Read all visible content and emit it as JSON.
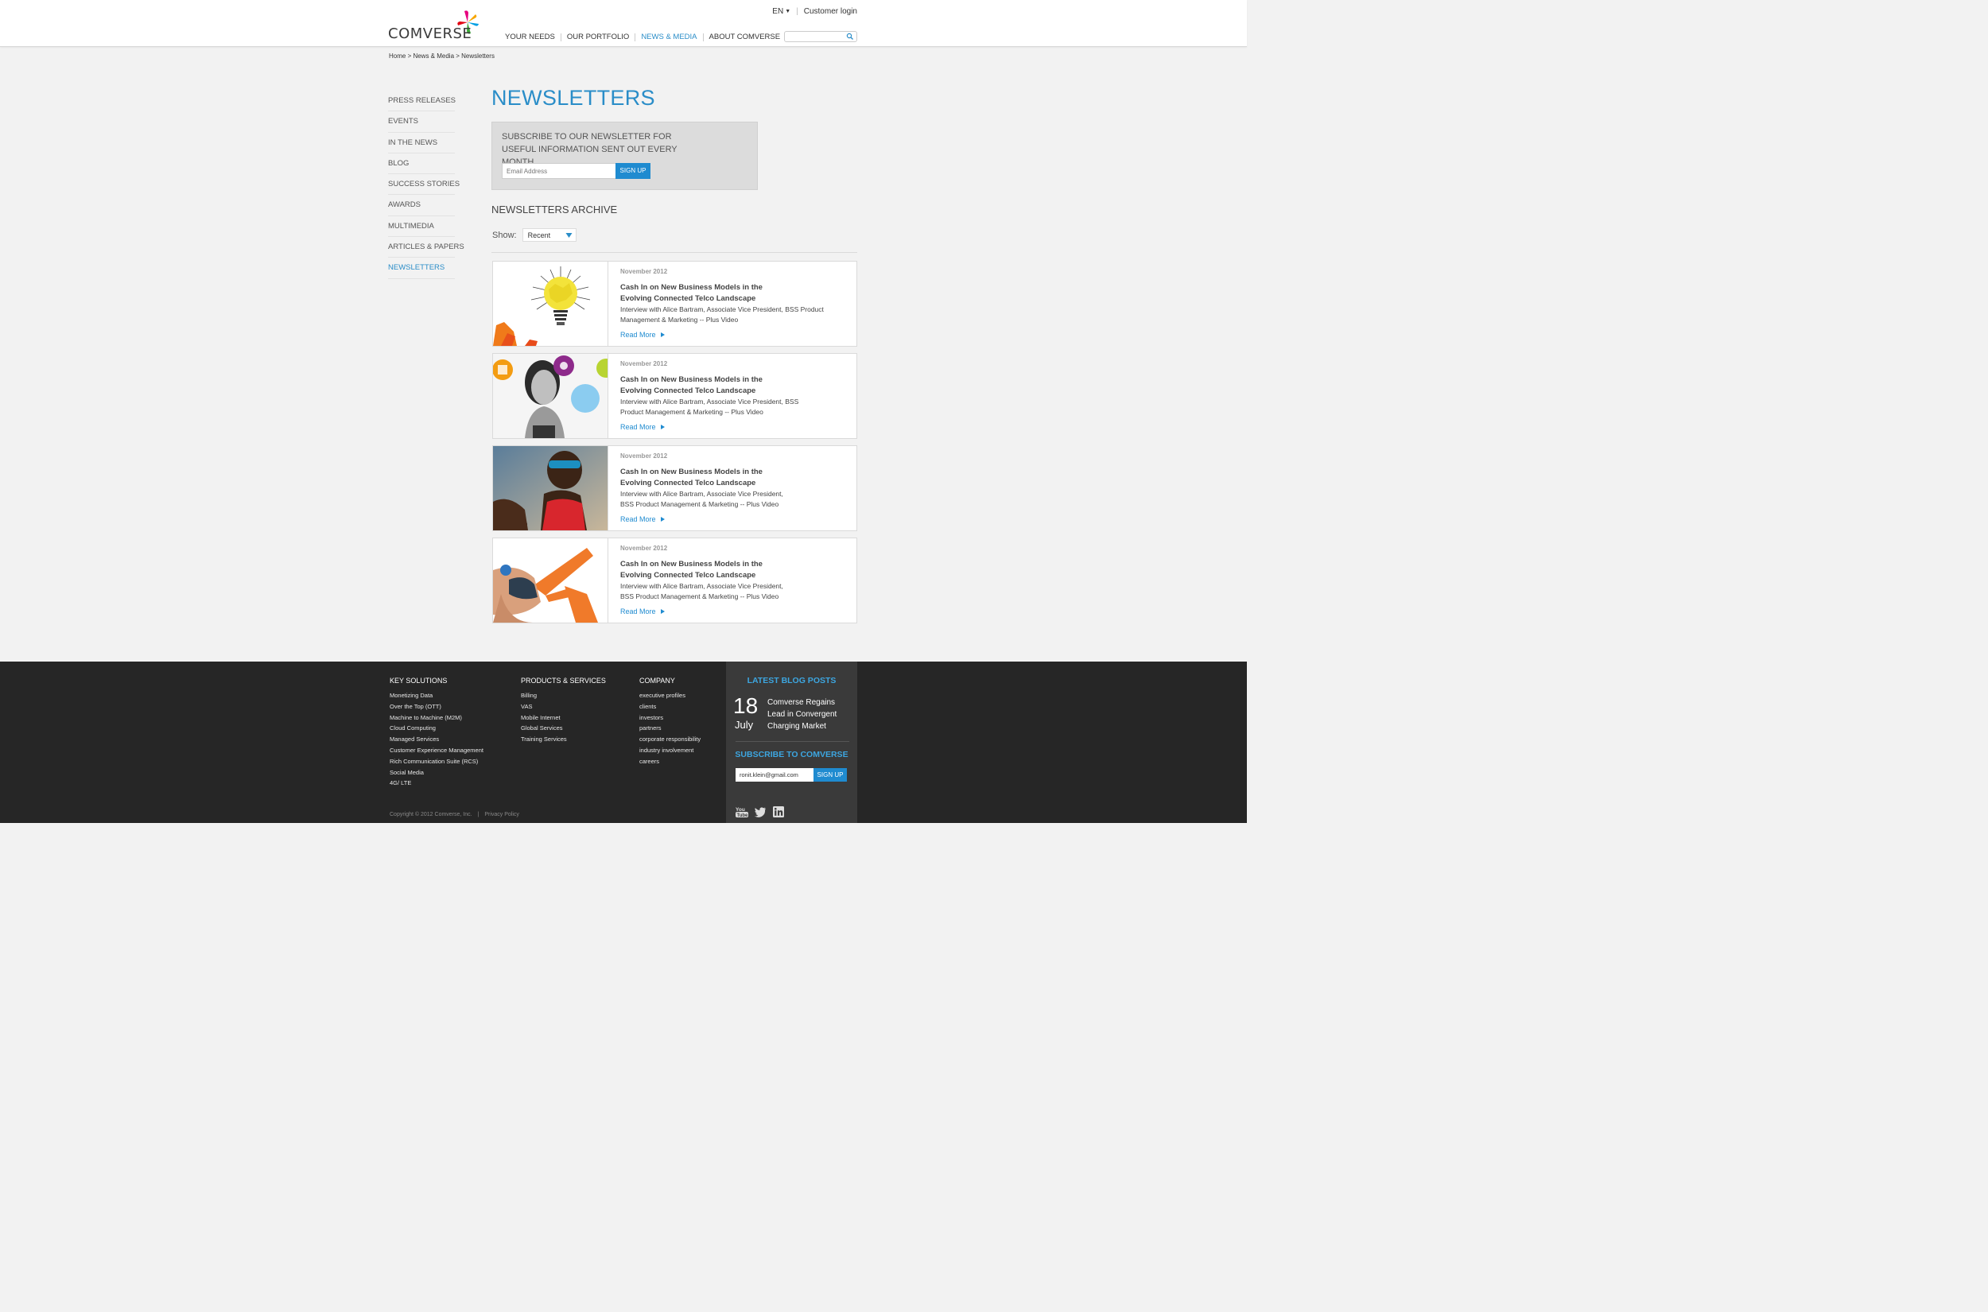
{
  "header": {
    "logo_text": "COMVERSE",
    "lang": "EN",
    "customer_login": "Customer login",
    "nav": [
      "YOUR NEEDS",
      "OUR PORTFOLIO",
      "NEWS & MEDIA",
      "ABOUT COMVERSE"
    ],
    "active_nav": "NEWS & MEDIA",
    "search_placeholder": ""
  },
  "breadcrumb": "Home > News & Media > Newsletters",
  "sidebar": {
    "items": [
      "PRESS RELEASES",
      "EVENTS",
      "IN THE NEWS",
      "BLOG",
      "SUCCESS STORIES",
      "AWARDS",
      "MULTIMEDIA",
      "ARTICLES & PAPERS",
      "NEWSLETTERS"
    ],
    "active": "NEWSLETTERS"
  },
  "main": {
    "title": "NEWSLETTERS",
    "subscribe": {
      "text": "SUBSCRIBE TO OUR NEWSLETTER FOR USEFUL INFORMATION SENT OUT EVERY MONTH.",
      "placeholder": "Email Address",
      "button": "SIGN UP"
    },
    "archive_title": "NEWSLETTERS ARCHIVE",
    "show_label": "Show:",
    "show_value": "Recent",
    "cards": [
      {
        "date": "November 2012",
        "title": "Cash In on New Business Models in the Evolving Connected Telco Landscape",
        "desc": "Interview with Alice Bartram, Associate Vice President, BSS Product Management & Marketing -- Plus Video",
        "more": "Read More",
        "thumb": "lightbulb-image"
      },
      {
        "date": "November 2012",
        "title": "Cash In on New Business Models in the Evolving Connected Telco Landscape",
        "desc": "Interview with Alice Bartram, Associate Vice President, BSS Product Management & Marketing -- Plus Video",
        "more": "Read More",
        "thumb": "woman-app-icons-image"
      },
      {
        "date": "November 2012",
        "title": "Cash In on New Business Models in the Evolving Connected Telco Landscape",
        "desc": "Interview with Alice Bartram, Associate Vice President, BSS Product Management & Marketing -- Plus Video",
        "more": "Read More",
        "thumb": "runner-image"
      },
      {
        "date": "November 2012",
        "title": "Cash In on New Business Models in the Evolving Connected Telco Landscape",
        "desc": "Interview with Alice Bartram, Associate Vice President, BSS Product Management & Marketing -- Plus Video",
        "more": "Read More",
        "thumb": "slingshot-image"
      }
    ]
  },
  "footer": {
    "key_solutions": {
      "heading": "KEY SOLUTIONS",
      "links": [
        "Monetizing Data",
        "Over the Top (OTT)",
        "Machine to Machine (M2M)",
        "Cloud Computing",
        "Managed Services",
        "Customer Experience Management",
        "Rich Communication Suite (RCS)",
        "Social Media",
        "4G/ LTE"
      ]
    },
    "products": {
      "heading": "PRODUCTS & SERVICES",
      "links": [
        "Billing",
        "VAS",
        "Mobile Internet",
        "Global Services",
        "Training Services"
      ]
    },
    "company": {
      "heading": "COMPANY",
      "links": [
        "executive profiles",
        "clients",
        "investors",
        "partners",
        "corporate responsibility",
        "industry involvement",
        "careers"
      ]
    },
    "copyright": "Copyright © 2012 Comverse, Inc.",
    "privacy": "Privacy Policy",
    "blog": {
      "heading": "LATEST BLOG POSTS",
      "day": "18",
      "month": "July",
      "post_title": "Comverse Regains Lead in Convergent Charging Market"
    },
    "subscribe": {
      "heading": "SUBSCRIBE TO COMVERSE",
      "email_value": "ronit.klein@gmail.com",
      "button": "SIGN UP"
    },
    "social": [
      "youtube-icon",
      "twitter-icon",
      "linkedin-icon"
    ]
  },
  "colors": {
    "accent": "#2a8dc8",
    "button": "#1f8bd0",
    "footer_bg": "#262626",
    "blog_box_bg": "#3a3a3a"
  }
}
